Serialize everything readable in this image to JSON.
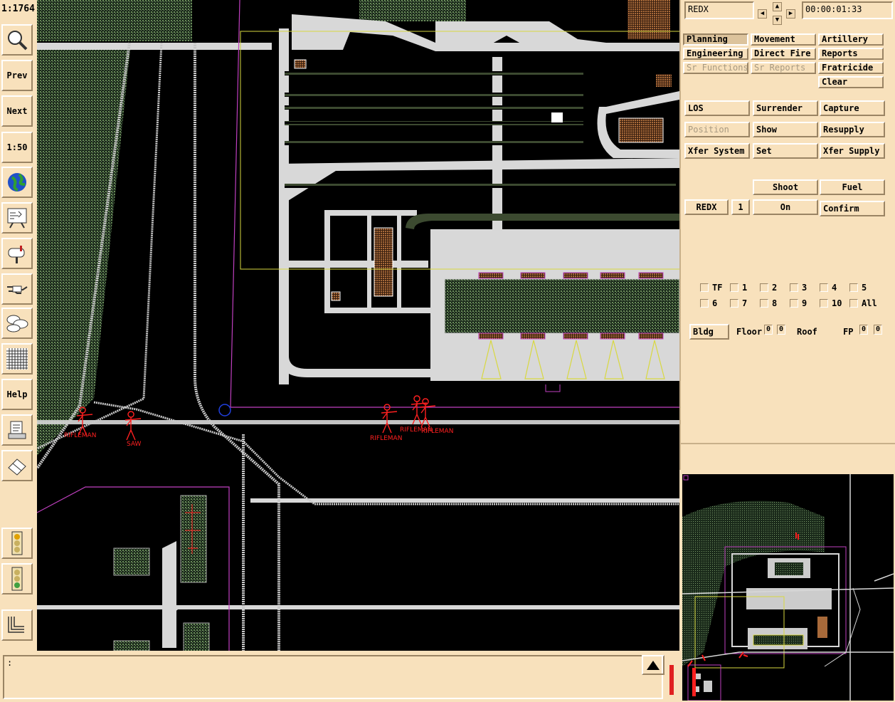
{
  "toolbar": {
    "scale": "1:1764",
    "prev_label": "Prev",
    "next_label": "Next",
    "zoom_label": "1:50",
    "help_label": "Help",
    "icons": [
      "magnifier-icon",
      "globe-icon",
      "briefing-board-icon",
      "mailbox-icon",
      "handshake-icon",
      "weather-clouds-icon",
      "grid-icon",
      "document-icon",
      "eraser-icon",
      "traffic-light-red-icon",
      "traffic-light-green-icon",
      "layers-icon"
    ]
  },
  "header": {
    "side": "REDX",
    "clock": "00:00:01:33"
  },
  "menu": {
    "row1": [
      "Planning",
      "Movement",
      "Artillery"
    ],
    "row2": [
      "Engineering",
      "Direct Fire",
      "Reports"
    ],
    "row3": [
      "Sr Functions",
      "Sr Reports",
      "Fratricide"
    ],
    "row4": [
      "Clear"
    ],
    "active": "Planning"
  },
  "actions": {
    "row1": [
      "LOS",
      "Surrender",
      "Capture"
    ],
    "row2": [
      "Position",
      "Show",
      "Resupply"
    ],
    "row3": [
      "Xfer System",
      "Set",
      "Xfer Supply"
    ],
    "shoot": "Shoot",
    "fuel": "Fuel",
    "unit": "REDX",
    "unit_num": "1",
    "on": "On",
    "confirm": "Confirm"
  },
  "filters": {
    "row1": [
      "TF",
      "1",
      "2",
      "3",
      "4",
      "5"
    ],
    "row2": [
      "6",
      "7",
      "8",
      "9",
      "10",
      "All"
    ]
  },
  "building": {
    "bldg_label": "Bldg",
    "floor_label": "Floor",
    "floor_values": [
      "0",
      "0"
    ],
    "roof_label": "Roof",
    "fp_label": "FP",
    "fp_values": [
      "0",
      "0"
    ]
  },
  "units": [
    {
      "label": "RIFLEMAN"
    },
    {
      "label": "SAW"
    },
    {
      "label": "RIFLEMAN"
    },
    {
      "label": "RIFLEMAN"
    },
    {
      "label": "RIFLEMAN"
    }
  ],
  "message": {
    "text": ":"
  },
  "colors": {
    "panel": "#f8e1bc",
    "map_bg": "#000000",
    "unit": "#ff2020",
    "boundary": "#c040c0",
    "selection": "#d8d840",
    "road": "#d8d8d8",
    "vegetation": "#3c5a3a"
  }
}
